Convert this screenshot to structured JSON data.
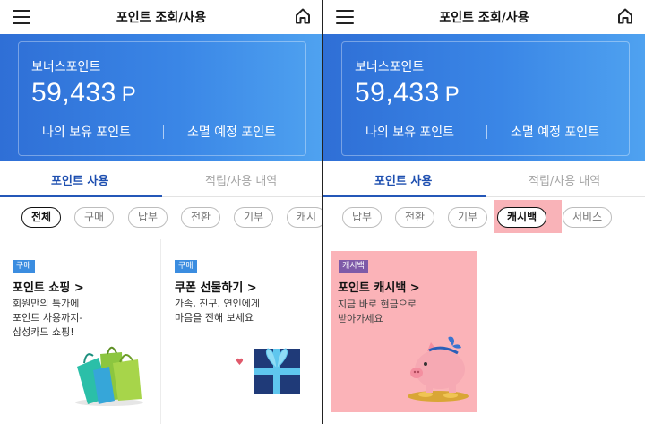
{
  "header": {
    "title": "포인트 조회/사용"
  },
  "banner": {
    "bonus_label": "보너스포인트",
    "bonus_value": "59,433",
    "bonus_unit": "P",
    "owned_link": "나의 보유 포인트",
    "expire_link": "소멸 예정 포인트"
  },
  "tabs": {
    "use": "포인트 사용",
    "history": "적립/사용 내역"
  },
  "left_chips": [
    "전체",
    "구매",
    "납부",
    "전환",
    "기부",
    "캐시"
  ],
  "right_chips": [
    "납부",
    "전환",
    "기부",
    "캐시백",
    "서비스"
  ],
  "cards": {
    "shopping": {
      "badge": "구매",
      "title": "포인트 쇼핑 >",
      "desc1": "회원만의 특가에",
      "desc2": "포인트 사용까지-",
      "desc3": "삼성카드 쇼핑!"
    },
    "gift": {
      "badge": "구매",
      "title": "쿠폰 선물하기 >",
      "desc1": "가족, 친구, 연인에게",
      "desc2": "마음을 전해 보세요"
    },
    "cashback": {
      "badge": "캐시백",
      "title": "포인트 캐시백 >",
      "desc1": "지금 바로 현금으로",
      "desc2": "받아가세요"
    }
  },
  "colors": {
    "banner_start": "#2f6fd6",
    "banner_end": "#4fa2f0",
    "tab_active": "#1e4fb0",
    "highlight": "#f9b3b8",
    "badge_blue": "#3b8de0",
    "badge_purple": "#7e5aa8"
  },
  "icons": {
    "menu": "hamburger-menu-icon",
    "home": "home-icon",
    "shopping": "shopping-bags-illustration",
    "gift": "gift-box-illustration",
    "cashback": "piggy-bank-illustration"
  }
}
